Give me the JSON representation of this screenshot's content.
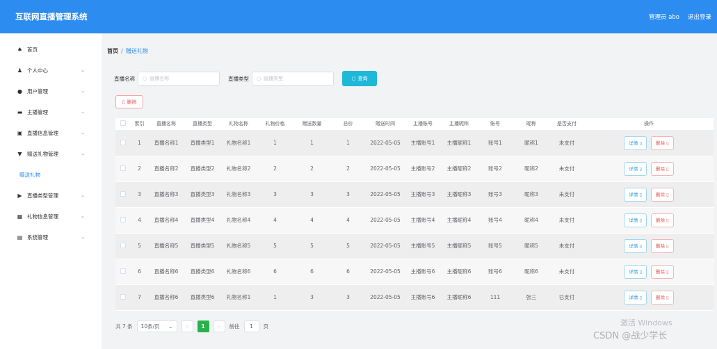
{
  "header": {
    "title": "互联网直播管理系统",
    "admin": "管理员 abo",
    "logout": "退出登录"
  },
  "sidebar": {
    "items": [
      {
        "icon": "home-icon",
        "glyph": "♠",
        "label": "首页",
        "chev": false
      },
      {
        "icon": "user-icon",
        "glyph": "♟",
        "label": "个人中心",
        "chev": true
      },
      {
        "icon": "users-icon",
        "glyph": "●",
        "label": "用户管理",
        "chev": true
      },
      {
        "icon": "broadcaster-icon",
        "glyph": "▬",
        "label": "主播管理",
        "chev": true
      },
      {
        "icon": "live-info-icon",
        "glyph": "▣",
        "label": "直播信息管理",
        "chev": true
      },
      {
        "icon": "gift-icon",
        "glyph": "▼",
        "label": "赠送礼物管理",
        "chev": true
      },
      {
        "icon": "gift-sub-icon",
        "glyph": "",
        "label": "赠送礼物",
        "chev": false,
        "sub": true
      },
      {
        "icon": "flag-icon",
        "glyph": "▶",
        "label": "直播类型管理",
        "chev": true
      },
      {
        "icon": "grid-icon",
        "glyph": "▦",
        "label": "礼物信息管理",
        "chev": true
      },
      {
        "icon": "system-icon",
        "glyph": "▤",
        "label": "系统管理",
        "chev": true
      }
    ]
  },
  "breadcrumb": {
    "home": "首页",
    "sep": "/",
    "current": "赠送礼物"
  },
  "search": {
    "name_label": "直播名称",
    "name_placeholder": "直播名称",
    "type_label": "直播类型",
    "type_placeholder": "直播类型",
    "button": "查询"
  },
  "toolbar": {
    "delete": "删除"
  },
  "table": {
    "headers": [
      "",
      "索引",
      "直播名称",
      "直播类型",
      "礼物名称",
      "礼物价格",
      "赠送数量",
      "总价",
      "赠送时间",
      "主播账号",
      "主播昵称",
      "账号",
      "昵称",
      "是否支付",
      "操作"
    ],
    "rows": [
      {
        "idx": "1",
        "name": "直播名称1",
        "type": "直播类型1",
        "gift": "礼物名称1",
        "price": "1",
        "qty": "1",
        "total": "1",
        "time": "2022-05-05",
        "account": "主播账号1",
        "nick": "主播昵称1",
        "user": "账号1",
        "unick": "昵称1",
        "paid": "未支付"
      },
      {
        "idx": "2",
        "name": "直播名称2",
        "type": "直播类型2",
        "gift": "礼物名称2",
        "price": "2",
        "qty": "2",
        "total": "2",
        "time": "2022-05-05",
        "account": "主播账号2",
        "nick": "主播昵称2",
        "user": "账号2",
        "unick": "昵称2",
        "paid": "未支付"
      },
      {
        "idx": "3",
        "name": "直播名称3",
        "type": "直播类型3",
        "gift": "礼物名称3",
        "price": "3",
        "qty": "3",
        "total": "3",
        "time": "2022-05-05",
        "account": "主播账号3",
        "nick": "主播昵称3",
        "user": "账号3",
        "unick": "昵称3",
        "paid": "未支付"
      },
      {
        "idx": "4",
        "name": "直播名称4",
        "type": "直播类型4",
        "gift": "礼物名称4",
        "price": "4",
        "qty": "4",
        "total": "4",
        "time": "2022-05-05",
        "account": "主播账号4",
        "nick": "主播昵称4",
        "user": "账号4",
        "unick": "昵称4",
        "paid": "未支付"
      },
      {
        "idx": "5",
        "name": "直播名称5",
        "type": "直播类型5",
        "gift": "礼物名称5",
        "price": "5",
        "qty": "5",
        "total": "5",
        "time": "2022-05-05",
        "account": "主播账号5",
        "nick": "主播昵称5",
        "user": "账号5",
        "unick": "昵称5",
        "paid": "未支付"
      },
      {
        "idx": "6",
        "name": "直播名称6",
        "type": "直播类型6",
        "gift": "礼物名称6",
        "price": "6",
        "qty": "6",
        "total": "6",
        "time": "2022-05-05",
        "account": "主播账号6",
        "nick": "主播昵称6",
        "user": "账号6",
        "unick": "昵称6",
        "paid": "未支付"
      },
      {
        "idx": "7",
        "name": "直播名称6",
        "type": "直播类型6",
        "gift": "礼物名称1",
        "price": "1",
        "qty": "3",
        "total": "3",
        "time": "2022-05-05",
        "account": "主播账号6",
        "nick": "主播昵称6",
        "user": "111",
        "unick": "张三",
        "paid": "已支付"
      }
    ],
    "detail_label": "详情",
    "delete_label": "删除"
  },
  "pagination": {
    "total": "共 7 条",
    "page_size": "10条/页",
    "current": "1",
    "goto": "前往",
    "goto_value": "1",
    "page_suffix": "页"
  },
  "watermark": {
    "windows": "激活 Windows",
    "csdn": "CSDN @战少学长"
  }
}
